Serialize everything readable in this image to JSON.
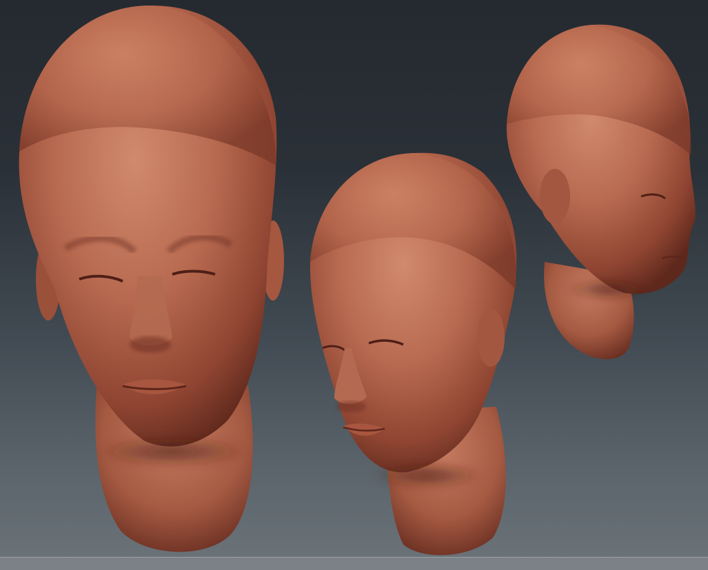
{
  "viewport": {
    "background_top": "#252a30",
    "background_bottom": "#6a7278",
    "clay_color": "#b8664f",
    "clay_highlight": "#d48a70",
    "clay_shadow": "#6e2f22"
  },
  "models": [
    {
      "view": "front"
    },
    {
      "view": "three-quarter"
    },
    {
      "view": "side"
    }
  ]
}
